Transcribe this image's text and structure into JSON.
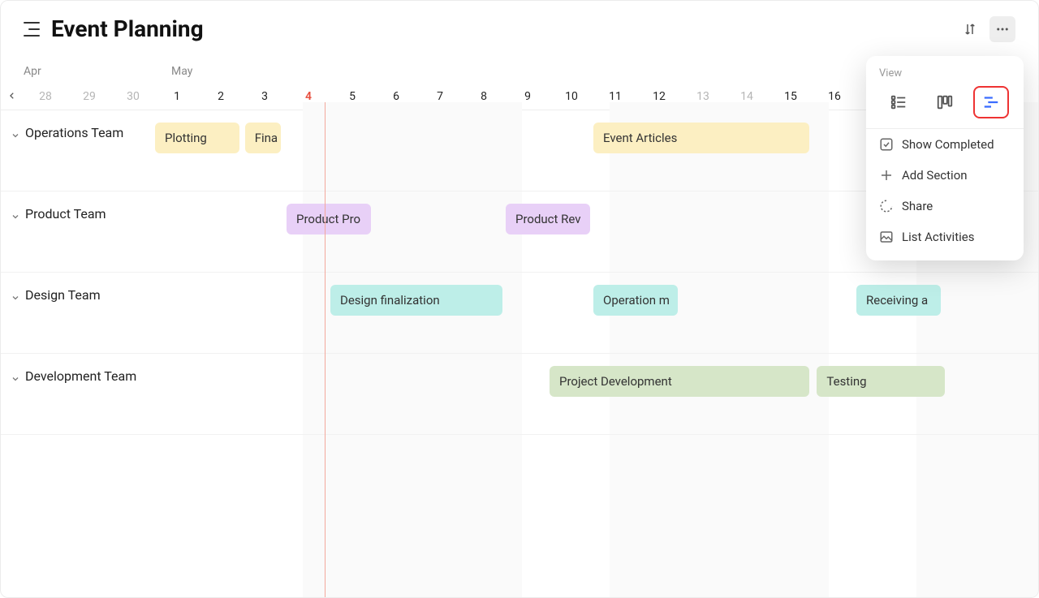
{
  "header": {
    "title": "Event Planning"
  },
  "months": {
    "apr": "Apr",
    "may": "May"
  },
  "days": [
    {
      "n": "28",
      "faded": true
    },
    {
      "n": "29",
      "faded": true
    },
    {
      "n": "30",
      "faded": true
    },
    {
      "n": "1"
    },
    {
      "n": "2"
    },
    {
      "n": "3"
    },
    {
      "n": "4",
      "today": true
    },
    {
      "n": "5"
    },
    {
      "n": "6"
    },
    {
      "n": "7"
    },
    {
      "n": "8"
    },
    {
      "n": "9"
    },
    {
      "n": "10"
    },
    {
      "n": "11"
    },
    {
      "n": "12"
    },
    {
      "n": "13",
      "faded": true
    },
    {
      "n": "14",
      "faded": true
    },
    {
      "n": "15"
    },
    {
      "n": "16"
    }
  ],
  "sections": [
    {
      "name": "Operations Team",
      "tasks": [
        {
          "label": "Plotting",
          "color": "c-yellow",
          "start": 3,
          "span": 2
        },
        {
          "label": "Fina",
          "color": "c-yellow",
          "start": 5.05,
          "span": 0.9
        },
        {
          "label": "Event Articles",
          "color": "c-yellow",
          "start": 13,
          "span": 5
        }
      ]
    },
    {
      "name": "Product Team",
      "tasks": [
        {
          "label": "Product Pro",
          "color": "c-purple",
          "start": 6,
          "span": 2
        },
        {
          "label": "Product Rev",
          "color": "c-purple",
          "start": 11,
          "span": 2
        }
      ]
    },
    {
      "name": "Design Team",
      "tasks": [
        {
          "label": "Design finalization",
          "color": "c-teal",
          "start": 7,
          "span": 4
        },
        {
          "label": "Operation m",
          "color": "c-teal",
          "start": 13,
          "span": 2
        },
        {
          "label": "Receiving a",
          "color": "c-teal",
          "start": 19,
          "span": 2
        }
      ]
    },
    {
      "name": "Development Team",
      "tasks": [
        {
          "label": "Project Development",
          "color": "c-green",
          "start": 12,
          "span": 6
        },
        {
          "label": "Testing",
          "color": "c-green",
          "start": 18.1,
          "span": 3
        }
      ]
    }
  ],
  "dropdown": {
    "title": "View",
    "items": {
      "show_completed": "Show Completed",
      "add_section": "Add Section",
      "share": "Share",
      "list_activities": "List Activities"
    }
  }
}
